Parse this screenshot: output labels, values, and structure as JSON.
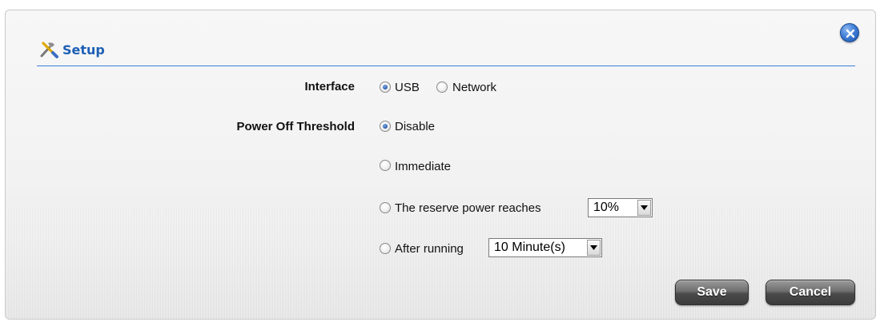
{
  "dialog": {
    "title": "Setup",
    "close_icon": "close-icon"
  },
  "interface": {
    "label": "Interface",
    "selected": "USB",
    "options": [
      "USB",
      "Network"
    ]
  },
  "power_off_threshold": {
    "label": "Power Off Threshold",
    "selected": "Disable",
    "disable_label": "Disable",
    "immediate_label": "Immediate",
    "reserve_label": "The reserve power reaches",
    "reserve_value": "10%",
    "after_running_label": "After running",
    "after_running_value": "10 Minute(s)"
  },
  "buttons": {
    "save_label": "Save",
    "cancel_label": "Cancel"
  },
  "colors": {
    "accent": "#1d5fb5",
    "divider": "#3b7dd8"
  }
}
